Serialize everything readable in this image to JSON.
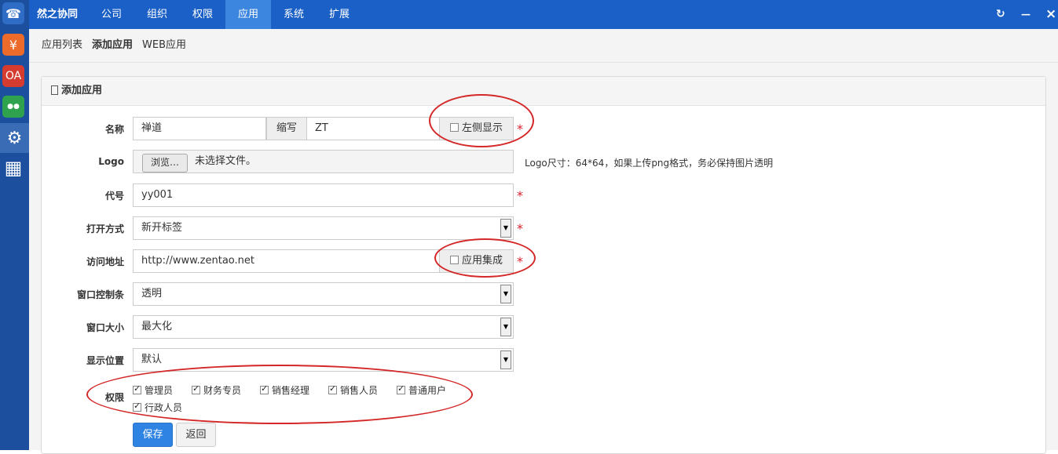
{
  "dock": {
    "items": [
      {
        "icon": "phone-icon",
        "glyph": "☎",
        "color": "#2f6cc5"
      },
      {
        "icon": "finance-icon",
        "glyph": "¥",
        "color": "#ec6a2a"
      },
      {
        "icon": "oa-icon",
        "glyph": "OA",
        "color": "#d63b2f"
      },
      {
        "icon": "team-icon",
        "glyph": "●●",
        "color": "#2fa24d"
      },
      {
        "icon": "settings-icon",
        "glyph": "⚙",
        "color": "#3a6bb5"
      },
      {
        "icon": "apps-grid-icon",
        "glyph": "▦",
        "color": "#1d4f9f"
      }
    ]
  },
  "topbar": {
    "brand": "然之协同",
    "nav": [
      "公司",
      "组织",
      "权限",
      "应用",
      "系统",
      "扩展"
    ],
    "active": "应用",
    "refresh_glyph": "↻",
    "minimize_glyph": "—",
    "close_glyph": "×"
  },
  "subnav": {
    "items": [
      "应用列表",
      "添加应用",
      "WEB应用"
    ],
    "active": "添加应用"
  },
  "panel": {
    "title": "添加应用",
    "title_icon": "document-icon"
  },
  "form": {
    "name": {
      "label": "名称",
      "value": "禅道",
      "abbr_label": "缩写",
      "abbr_value": "ZT",
      "left_show_label": "左侧显示"
    },
    "logo": {
      "label": "Logo",
      "browse_label": "浏览…",
      "file_status": "未选择文件。",
      "hint": "Logo尺寸：64*64，如果上传png格式，务必保持图片透明"
    },
    "code": {
      "label": "代号",
      "value": "yy001"
    },
    "open_mode": {
      "label": "打开方式",
      "value": "新开标签"
    },
    "url": {
      "label": "访问地址",
      "value": "http://www.zentao.net",
      "integrate_label": "应用集成"
    },
    "window_bar": {
      "label": "窗口控制条",
      "value": "透明"
    },
    "window_size": {
      "label": "窗口大小",
      "value": "最大化"
    },
    "position": {
      "label": "显示位置",
      "value": "默认"
    },
    "permissions": {
      "label": "权限",
      "items": [
        "管理员",
        "财务专员",
        "销售经理",
        "销售人员",
        "普通用户",
        "行政人员"
      ]
    },
    "required_mark": "*",
    "save_label": "保存",
    "back_label": "返回"
  },
  "colors": {
    "primary": "#1b60c6",
    "active_tab": "#3d86e0",
    "required": "#d9202b",
    "annotation": "#d42828",
    "save_button": "#2f83e3"
  }
}
